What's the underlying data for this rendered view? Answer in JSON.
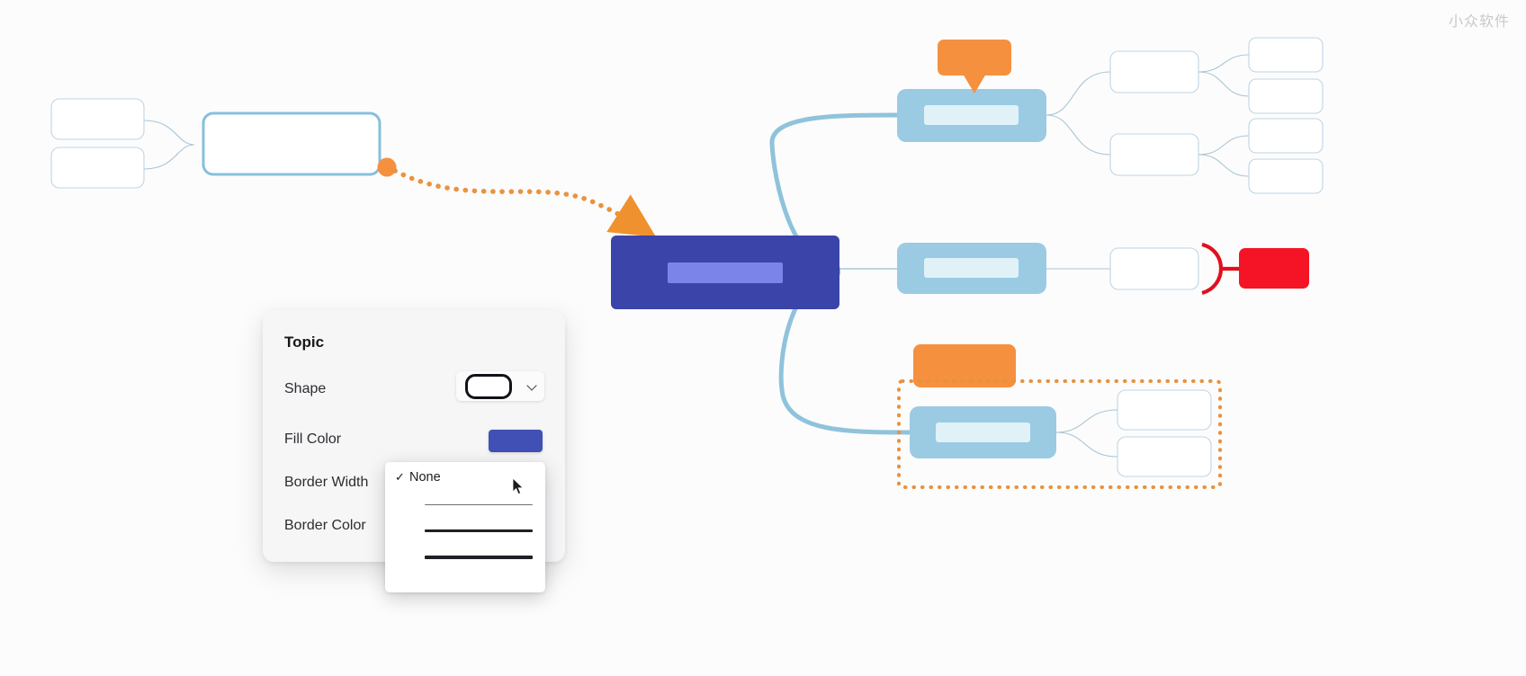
{
  "watermark": {
    "text": "小众软件"
  },
  "colors": {
    "canvas_bg": "#fdfcfc",
    "node_light_blue": "#9acbe3",
    "node_light_blue_inner": "#e0f1f8",
    "node_dark_indigo": "#3b44a8",
    "node_dark_indigo_inner": "#7b84e8",
    "node_red": "#f51425",
    "connector_red": "#e01020",
    "accent_orange": "#f5903f",
    "selection_orange": "#e8913d",
    "node_outline_blue": "#b9d4e6",
    "branch_blue": "#8fc3dc",
    "selected_border_blue": "#86c0dd"
  },
  "panel": {
    "title": "Topic",
    "rows": [
      {
        "label": "Shape"
      },
      {
        "label": "Fill Color"
      },
      {
        "label": "Border Width"
      },
      {
        "label": "Border Color"
      }
    ],
    "shape_value": "rounded-rectangle",
    "shape_chevron": "chevron-down-icon",
    "fill_color_value": "#4050b5"
  },
  "dropdown": {
    "name": "border-width-menu",
    "items": [
      {
        "label": "None",
        "selected": true,
        "checkmark": "✓",
        "thickness": 0
      },
      {
        "label": "",
        "selected": false,
        "checkmark": "",
        "thickness": 1.5
      },
      {
        "label": "",
        "selected": false,
        "checkmark": "",
        "thickness": 2.6
      },
      {
        "label": "",
        "selected": false,
        "checkmark": "",
        "thickness": 4
      }
    ]
  },
  "mindmap": {
    "central_node": {
      "name": "central-topic-node",
      "fill": "#3b44a8",
      "inner_bar": "#7b84e8"
    },
    "left_selected_node": {
      "name": "left-selected-node",
      "border": "#86c0dd"
    },
    "left_children": [
      {
        "name": "left-child-node-1"
      },
      {
        "name": "left-child-node-2"
      }
    ],
    "right_branches": [
      {
        "name": "branch-upper",
        "main_node": {
          "name": "subtopic-node-upper",
          "fill": "#9acbe3",
          "callout": "orange-callout-tooltip"
        },
        "children": [
          {
            "name": "child-node-1",
            "grandchildren": [
              "grandchild-node-1",
              "grandchild-node-2"
            ]
          },
          {
            "name": "child-node-2",
            "grandchildren": [
              "grandchild-node-3",
              "grandchild-node-4"
            ]
          }
        ]
      },
      {
        "name": "branch-middle",
        "main_node": {
          "name": "subtopic-node-middle",
          "fill": "#9acbe3"
        },
        "children": [
          {
            "name": "child-node-5",
            "red_link": true,
            "red_node": {
              "name": "red-highlight-node",
              "fill": "#f51425"
            }
          }
        ]
      },
      {
        "name": "branch-lower",
        "main_node": {
          "name": "subtopic-node-lower",
          "fill": "#9acbe3",
          "callout": "orange-callout-tab"
        },
        "selection_box": {
          "name": "dotted-selection-box",
          "color": "#e8913d"
        },
        "children": [
          {
            "name": "child-node-6"
          },
          {
            "name": "child-node-7"
          }
        ]
      }
    ],
    "drag_handle": {
      "name": "orange-drag-handle",
      "color": "#f5903f"
    },
    "dotted_connector": {
      "name": "dotted-relationship-arrow",
      "color": "#e8913d"
    }
  }
}
